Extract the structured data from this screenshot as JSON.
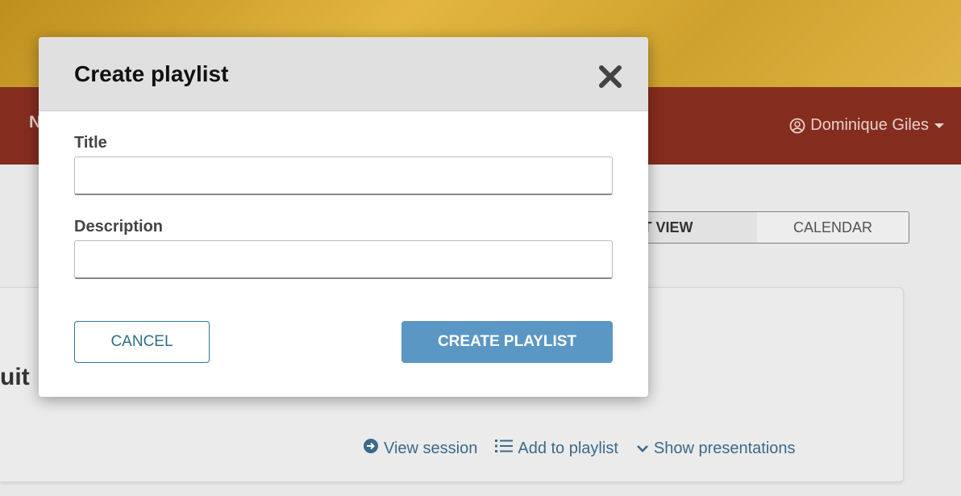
{
  "background": {
    "nav_initial": "N",
    "user_menu": {
      "name": "Dominique Giles",
      "icon": "user-circle-icon",
      "caret_icon": "caret-down-icon"
    },
    "view_toggle": {
      "list_label": "IST VIEW",
      "calendar_label": "CALENDAR"
    },
    "card": {
      "title_fragment": "uit",
      "actions": [
        {
          "label": "View session",
          "icon": "arrow-circle-right-icon"
        },
        {
          "label": "Add to playlist",
          "icon": "list-icon"
        },
        {
          "label": "Show presentations",
          "icon": "chevron-down-icon"
        }
      ]
    }
  },
  "modal": {
    "title": "Create playlist",
    "close_icon": "close-icon",
    "fields": {
      "title": {
        "label": "Title",
        "value": "",
        "placeholder": ""
      },
      "description": {
        "label": "Description",
        "value": "",
        "placeholder": ""
      }
    },
    "cancel_label": "CANCEL",
    "create_label": "CREATE PLAYLIST"
  },
  "colors": {
    "navbar": "#7a1c0c",
    "primary_button": "#5b97c4",
    "cancel_border": "#2a7a93",
    "link": "#2b5d80"
  }
}
